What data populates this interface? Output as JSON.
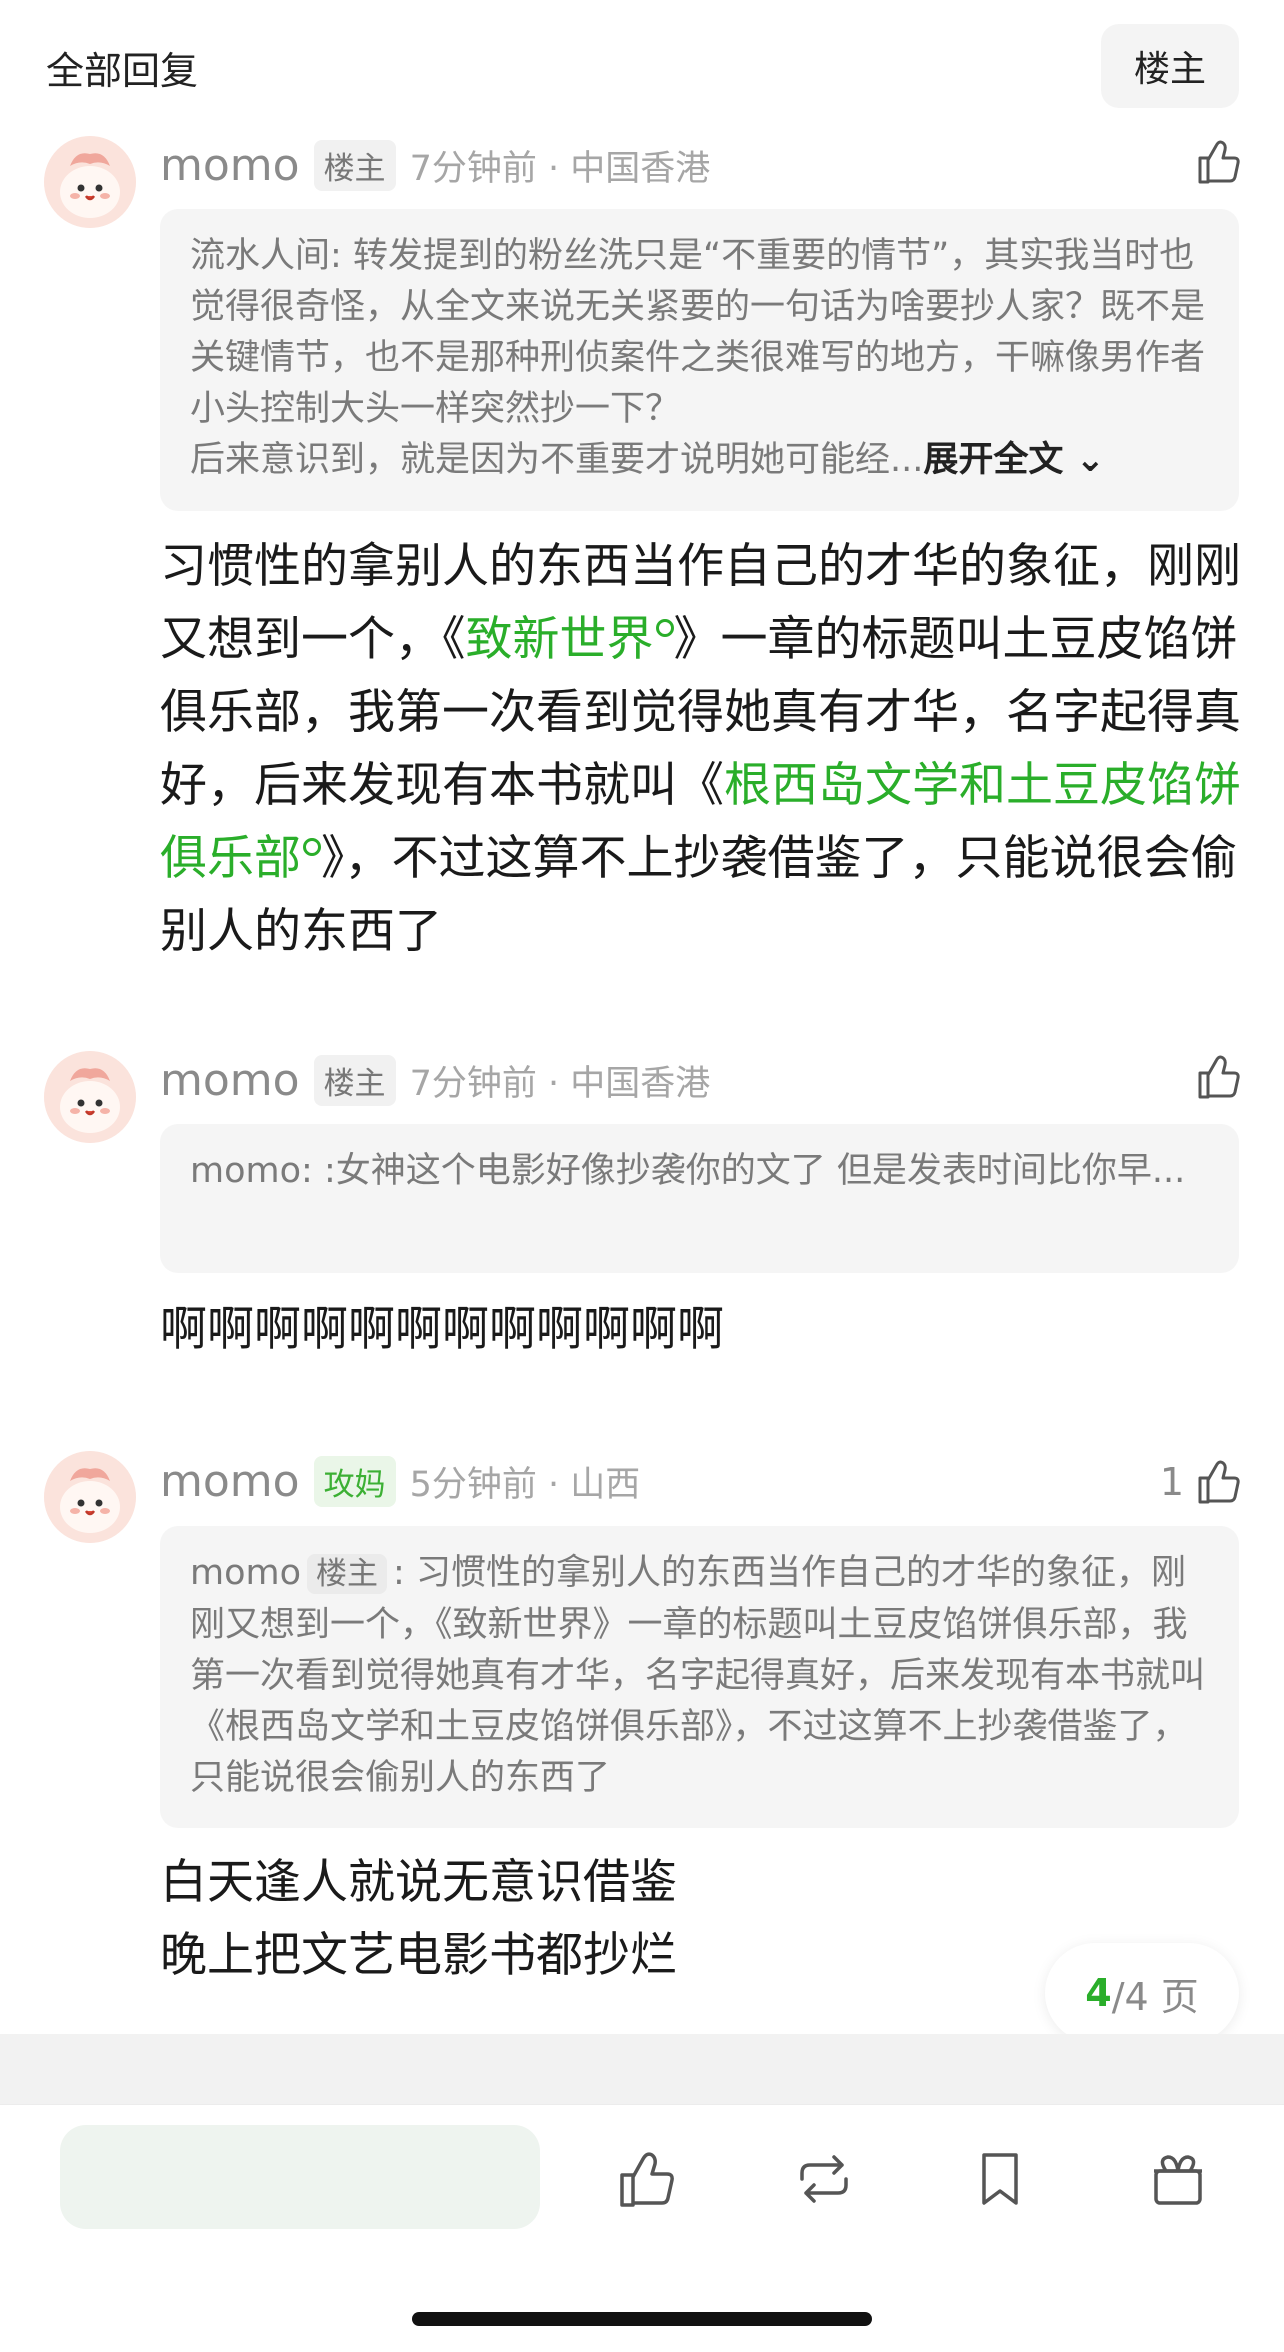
{
  "header": {
    "title": "全部回复",
    "floor_button": "楼主"
  },
  "comments": [
    {
      "username": "momo",
      "badge": "楼主",
      "time_location": "7分钟前 · 中国香港",
      "likes": "",
      "quote": {
        "author": "流水人间",
        "text": "转发提到的粉丝洗只是“不重要的情节”，其实我当时也觉得很奇怪，从全文来说无关紧要的一句话为啥要抄人家？既不是关键情节，也不是那种刑侦案件之类很难写的地方，干嘛像男作者小头控制大头一样突然抄一下？",
        "text2": "后来意识到，就是因为不重要才说明她可能经...",
        "expand": "展开全文"
      },
      "body": {
        "p1": "习惯性的拿别人的东西当作自己的才华的象征，刚刚又想到一个，《",
        "link1": "致新世界",
        "p2": "》一章的标题叫土豆皮馅饼俱乐部，我第一次看到觉得她真有才华，名字起得真好，后来发现有本书就叫《",
        "link2": "根西岛文学和土豆皮馅饼俱乐部",
        "p3": "》，不过这算不上抄袭借鉴了，只能说很会偷别人的东西了"
      }
    },
    {
      "username": "momo",
      "badge": "楼主",
      "time_location": "7分钟前 · 中国香港",
      "likes": "",
      "quote": {
        "author": "momo",
        "text": ":女神这个电影好像抄袭你的文了 但是发表时间比你早..."
      },
      "body": {
        "text": "啊啊啊啊啊啊啊啊啊啊啊啊"
      }
    },
    {
      "username": "momo",
      "badge": "攻妈",
      "time_location": "5分钟前 · 山西",
      "likes": "1",
      "quote": {
        "author": "momo",
        "author_badge": "楼主",
        "text": "习惯性的拿别人的东西当作自己的才华的象征，刚刚又想到一个，《致新世界》一章的标题叫土豆皮馅饼俱乐部，我第一次看到觉得她真有才华，名字起得真好，后来发现有本书就叫《根西岛文学和土豆皮馅饼俱乐部》，不过这算不上抄袭借鉴了，只能说很会偷别人的东西了"
      },
      "body": {
        "line1": "白天逢人就说无意识借鉴",
        "line2": "晚上把文艺电影书都抄烂"
      }
    }
  ],
  "pagination": {
    "current": "4",
    "total": "/4 页"
  },
  "toolbar": {
    "icons": [
      "like-icon",
      "repost-icon",
      "bookmark-icon",
      "gift-icon"
    ]
  },
  "colors": {
    "accent_green": "#2aae2a",
    "badge_grey": "#f1f1f1",
    "quote_bg": "#f5f5f5"
  }
}
